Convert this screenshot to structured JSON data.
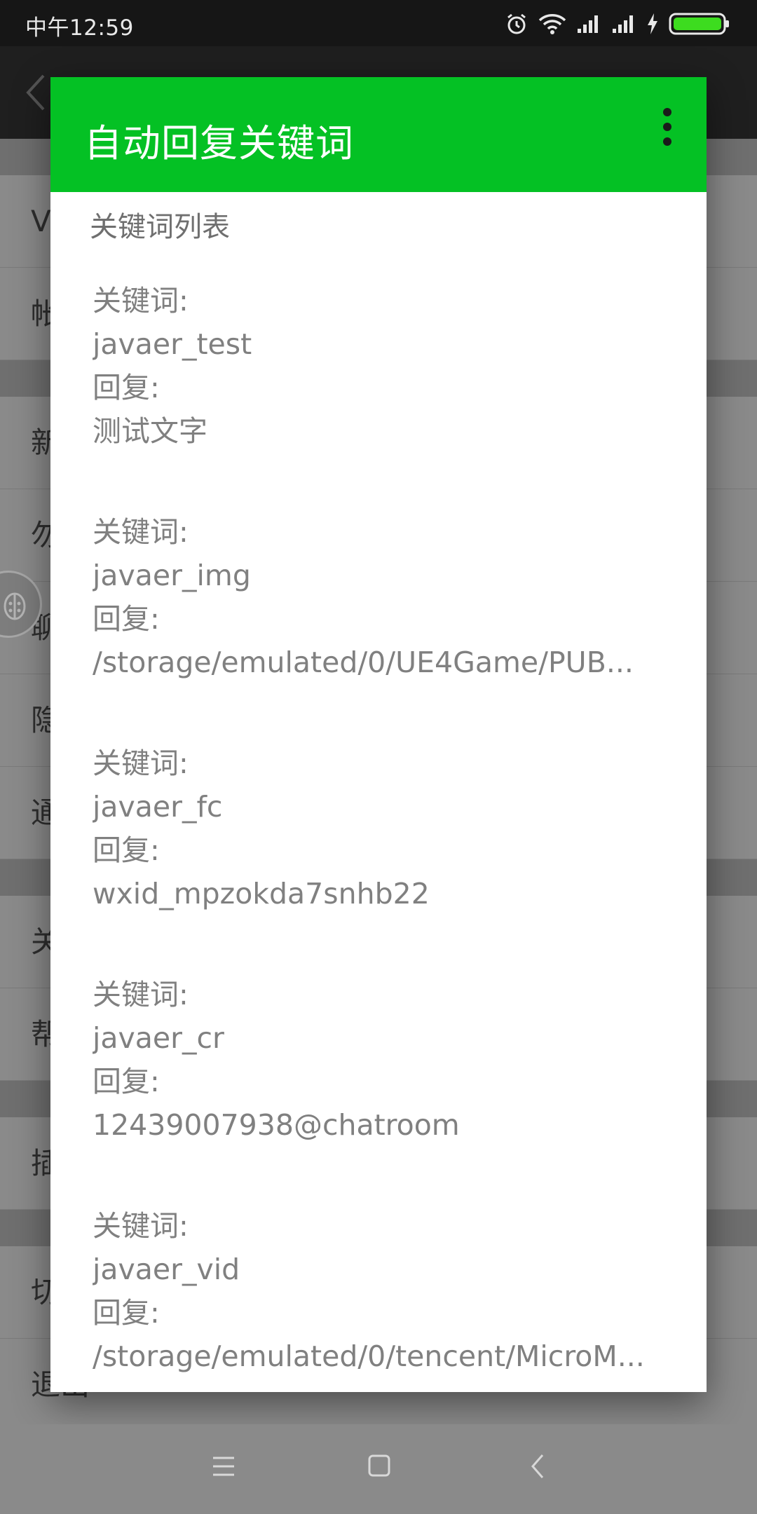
{
  "status_bar": {
    "time": "中午12:59",
    "icons": [
      "alarm-icon",
      "wifi-icon",
      "signal-icon",
      "signal-icon",
      "charging-icon",
      "battery-icon"
    ],
    "battery_color": "#3ddc1f"
  },
  "background": {
    "rows": [
      {
        "label": "V"
      },
      {
        "label": "帐"
      },
      {
        "label": "新"
      },
      {
        "label": "勿"
      },
      {
        "label": "聊"
      },
      {
        "label": "隐"
      },
      {
        "label": "通"
      },
      {
        "label": "关"
      },
      {
        "label": "帮"
      },
      {
        "label": "插"
      },
      {
        "label": "切"
      },
      {
        "label": "退出"
      }
    ]
  },
  "dialog": {
    "title": "自动回复关键词",
    "header_color": "#04c124",
    "section_title": "关键词列表",
    "entries": [
      {
        "keyword_label": "关键词:",
        "keyword": "javaer_test",
        "reply_label": "回复:",
        "reply": "测试文字"
      },
      {
        "keyword_label": "关键词:",
        "keyword": "javaer_img",
        "reply_label": "回复:",
        "reply": "/storage/emulated/0/UE4Game/PUB..."
      },
      {
        "keyword_label": "关键词:",
        "keyword": "javaer_fc",
        "reply_label": "回复:",
        "reply": "wxid_mpzokda7snhb22"
      },
      {
        "keyword_label": "关键词:",
        "keyword": "javaer_cr",
        "reply_label": "回复:",
        "reply": "12439007938@chatroom"
      },
      {
        "keyword_label": "关键词:",
        "keyword": "javaer_vid",
        "reply_label": "回复:",
        "reply": "/storage/emulated/0/tencent/MicroM..."
      }
    ]
  },
  "nav_bar": {
    "buttons": [
      "menu-icon",
      "home-icon",
      "back-icon"
    ]
  }
}
